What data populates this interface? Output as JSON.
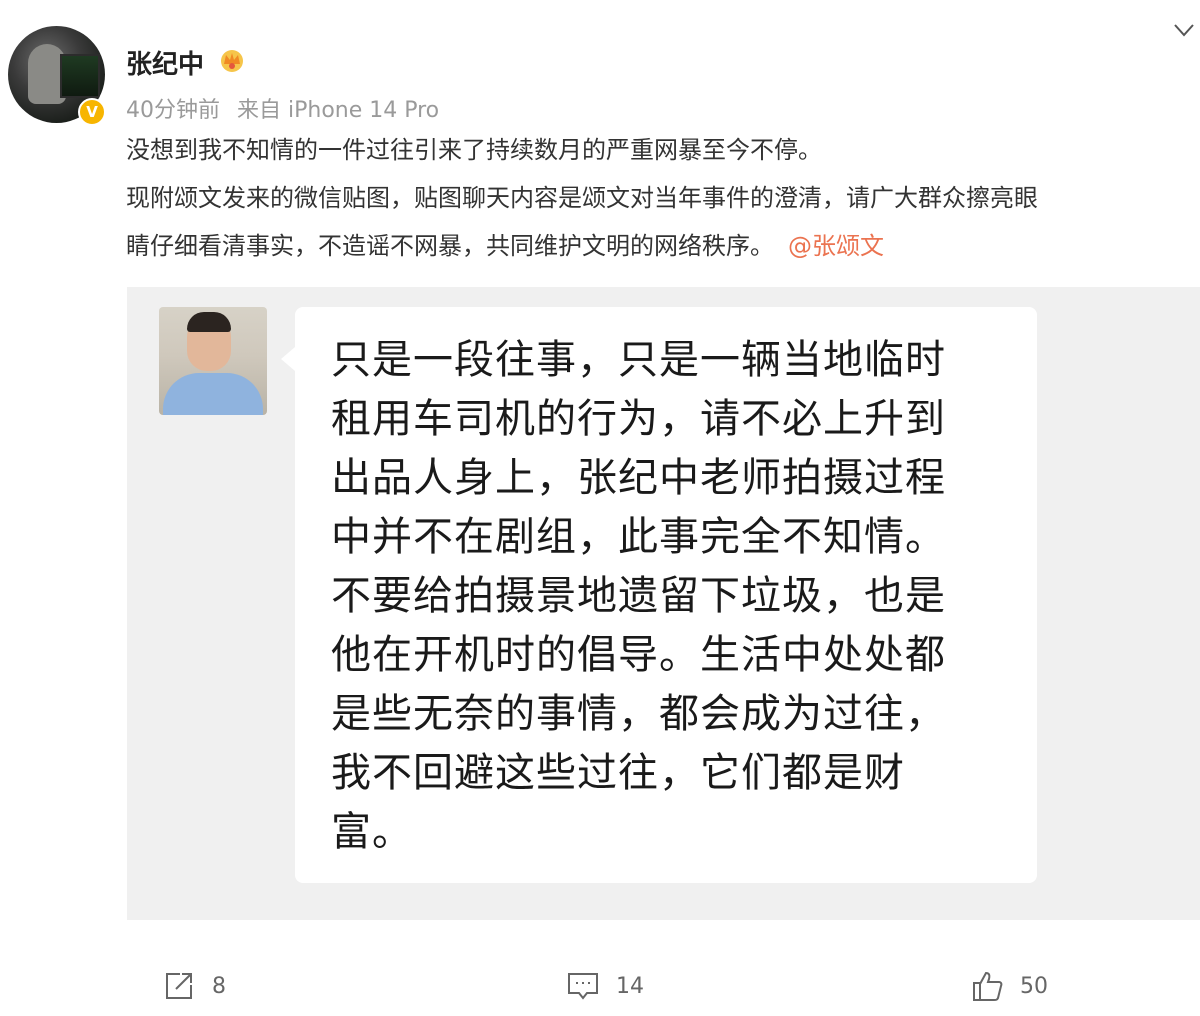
{
  "post": {
    "author": "张纪中",
    "meta": {
      "time": "40分钟前",
      "source": "来自 iPhone 14 Pro"
    },
    "text_lines": [
      "没想到我不知情的一件过往引来了持续数月的严重网暴至今不停。",
      "现附颂文发来的微信贴图，贴图聊天内容是颂文对当年事件的澄清，请广大群众擦亮眼",
      "睛仔细看清事实，不造谣不网暴，共同维护文明的网络秩序。"
    ],
    "mention": "@张颂文"
  },
  "chat_image": {
    "message_lines": [
      "只是一段往事，只是一辆当地临时",
      "租用车司机的行为，请不必上升到",
      "出品人身上，张纪中老师拍摄过程",
      "中并不在剧组，此事完全不知情。",
      "不要给拍摄景地遗留下垃圾，也是",
      "他在开机时的倡导。生活中处处都",
      "是些无奈的事情，都会成为过往，",
      "我不回避这些过往，它们都是财",
      "富。"
    ]
  },
  "actions": {
    "repost": {
      "icon": "share-icon",
      "count": "8"
    },
    "comment": {
      "icon": "comment-icon",
      "count": "14"
    },
    "like": {
      "icon": "thumbs-up-icon",
      "count": "50"
    }
  },
  "colors": {
    "mention": "#eb7350",
    "verified_badge": "#f7b500",
    "meta_text": "#9a9a9a"
  }
}
